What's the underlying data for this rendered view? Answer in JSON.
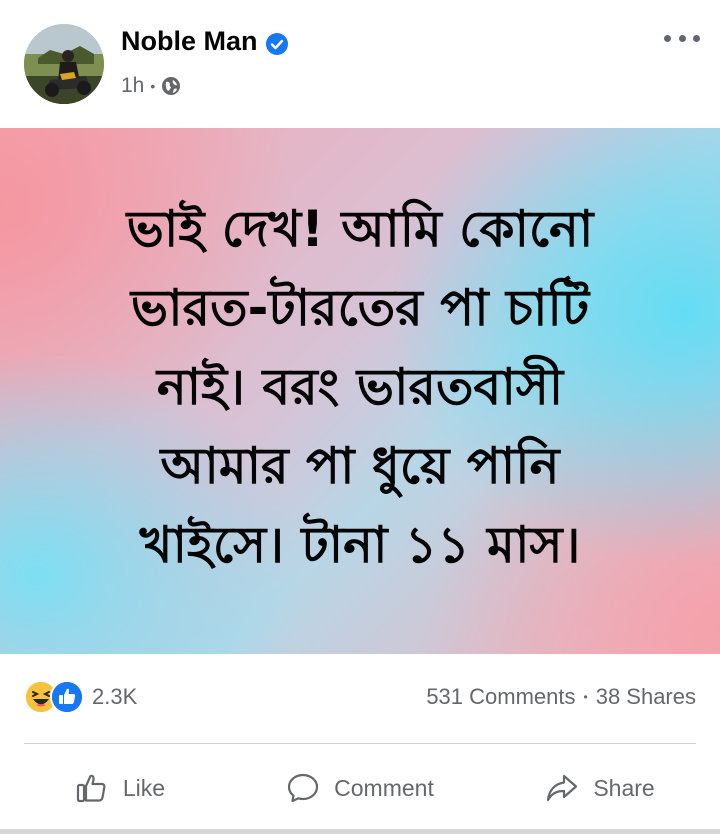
{
  "post": {
    "author": "Noble Man",
    "verified": true,
    "time": "1h",
    "privacy_icon": "globe-icon",
    "text": "ভাই দেখ! আমি কোনো\nভারত-টারতের পা চাটি\nনাই। বরং ভারতবাসী\nআমার পা ধুয়ে পানি\nখাইসে। টানা ১১ মাস।",
    "background_colors": [
      "#f3a7b4",
      "#5edef6",
      "#f5a0aa"
    ]
  },
  "engagement": {
    "reaction_icons": [
      "haha-reaction-icon",
      "like-reaction-icon"
    ],
    "reaction_count": "2.3K",
    "comments": "531 Comments",
    "shares": "38 Shares",
    "separator": "•"
  },
  "actions": {
    "like": "Like",
    "comment": "Comment",
    "share": "Share"
  },
  "colors": {
    "secondary_text": "#65676b",
    "brand_blue": "#1877f2"
  }
}
